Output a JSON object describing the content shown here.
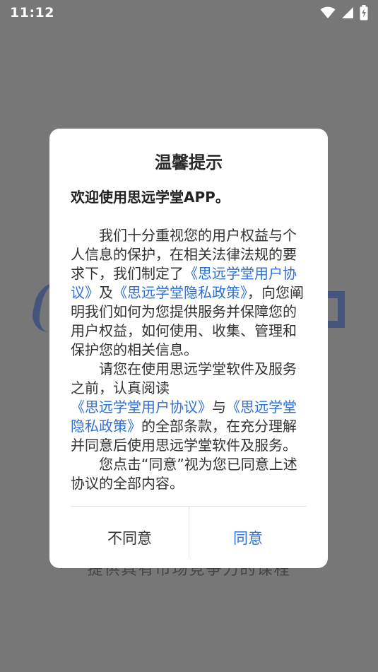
{
  "status_bar": {
    "time": "11:12",
    "icons": [
      "wifi-icon",
      "cellular-signal-icon",
      "battery-charging-icon"
    ]
  },
  "background": {
    "slogan": "提供具有市场竞争力的课程"
  },
  "dialog": {
    "title": "温馨提示",
    "welcome": "欢迎使用思远学堂APP。",
    "para1": {
      "t1": "我们十分重视您的用户权益与个人信息的保护，在相关法律法规的要求下，我们制定了",
      "link1": "《思远学堂用户协议》",
      "t2": "及",
      "link2": "《思远学堂隐私政策》",
      "t3": "，向您阐明我们如何为您提供服务并保障您的用户权益，如何使用、收集、管理和保护您的相关信息。"
    },
    "para2": {
      "t1": "请您在使用思远学堂软件及服务之前，认真阅读",
      "link1": "《思远学堂用户协议》",
      "t2": "与",
      "link2": "《思远学堂隐私政策》",
      "t3": "的全部条款，在充分理解并同意后使用思远学堂软件及服务。"
    },
    "para3": "您点击“同意”视为您已同意上述协议的全部内容。",
    "disagree_label": "不同意",
    "agree_label": "同意"
  },
  "colors": {
    "link": "#2f6fd6",
    "overlay": "#777777",
    "brand": "#3d4f7f"
  }
}
